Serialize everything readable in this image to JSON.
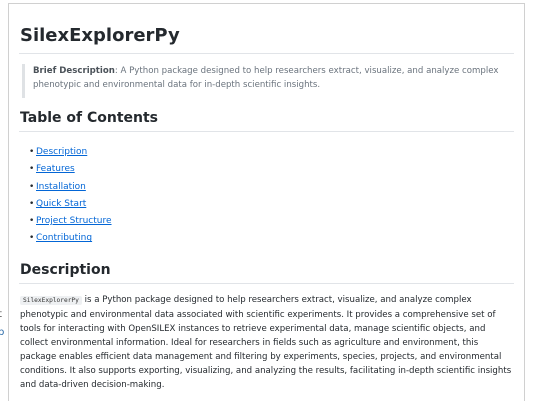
{
  "edge": {
    "line1": "t",
    "line2": "p"
  },
  "readme": {
    "title": "SilexExplorerPy",
    "brief_label": "Brief Description",
    "brief_text": ": A Python package designed to help researchers extract, visualize, and analyze complex phenotypic and environmental data for in-depth scientific insights.",
    "toc_heading": "Table of Contents",
    "toc_items": [
      {
        "label": "Description"
      },
      {
        "label": "Features"
      },
      {
        "label": "Installation"
      },
      {
        "label": "Quick Start"
      },
      {
        "label": "Project Structure"
      },
      {
        "label": "Contributing"
      }
    ],
    "description_heading": "Description",
    "description_code": "SilexExplorerPy",
    "description_text": " is a Python package designed to help researchers extract, visualize, and analyze complex phenotypic and environmental data associated with scientific experiments. It provides a comprehensive set of tools for interacting with OpenSILEX instances to retrieve experimental data, manage scientific objects, and collect environmental information. Ideal for researchers in fields such as agriculture and environment, this package enables efficient data management and filtering by experiments, species, projects, and environmental conditions. It also supports exporting, visualizing, and analyzing the results, facilitating in-depth scientific insights and data-driven decision-making."
  }
}
